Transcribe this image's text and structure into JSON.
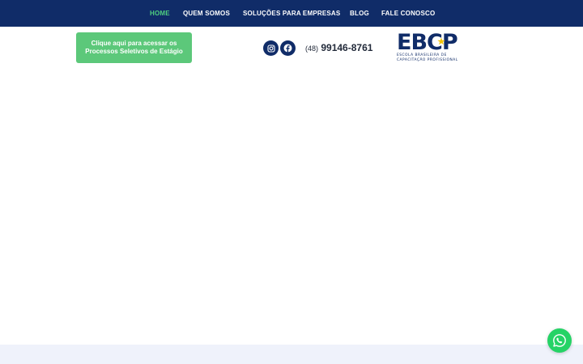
{
  "nav": {
    "items": [
      {
        "label": "HOME",
        "active": true
      },
      {
        "label": "QUEM SOMOS"
      },
      {
        "label": "SOLUÇÕES PARA EMPRESAS"
      },
      {
        "label": "BLOG"
      },
      {
        "label": "FALE CONOSCO"
      }
    ]
  },
  "cta": {
    "line1": "Clique aqui para acessar os",
    "line2": "Processos Seletivos de Estágio"
  },
  "social": [
    "instagram-icon",
    "facebook-icon"
  ],
  "contact": {
    "area_code": "(48)",
    "number": "99146-8761"
  },
  "logo": {
    "mark": "EBCP",
    "line1": "ESCOLA BRASILEIRA DE",
    "line2": "CAPACITAÇÃO PROFISSIONAL"
  },
  "colors": {
    "nav_bg": "#102c68",
    "nav_active": "#4fcf7f",
    "cta_bg": "#5cc87a",
    "whatsapp": "#25d366",
    "star": "#f2c200"
  },
  "floating": {
    "icon": "whatsapp-icon"
  }
}
